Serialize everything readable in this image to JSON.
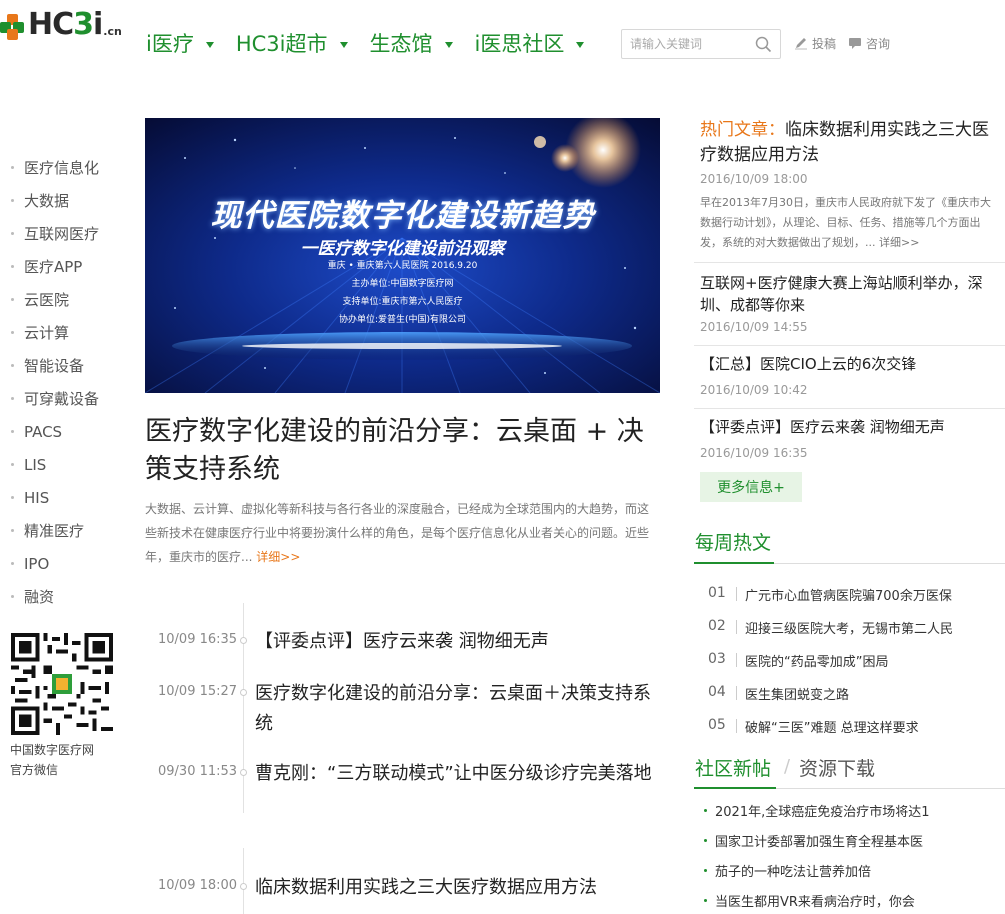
{
  "header": {
    "logo_text": "HC3i",
    "logo_suffix": ".cn",
    "nav": [
      {
        "label": "i医疗"
      },
      {
        "label": "HC3i超市"
      },
      {
        "label": "生态馆"
      },
      {
        "label": "i医思社区"
      }
    ],
    "search_placeholder": "请输入关键词",
    "contribute_label": "投稿",
    "consult_label": "咨询"
  },
  "sidebar": {
    "items": [
      "医疗信息化",
      "大数据",
      "互联网医疗",
      "医疗APP",
      "云医院",
      "云计算",
      "智能设备",
      "可穿戴设备",
      "PACS",
      "LIS",
      "HIS",
      "精准医疗",
      "IPO",
      "融资"
    ],
    "qr_caption_line1": "中国数字医疗网",
    "qr_caption_line2": "官方微信"
  },
  "hero": {
    "title": "现代医院数字化建设新趋势",
    "subtitle": "一医疗数字化建设前沿观察",
    "line1": "重庆 • 重庆第六人民医院  2016.9.20",
    "line2": "主办单位:中国数字医疗网",
    "line3": "支持单位:重庆市第六人民医疗",
    "line4": "协办单位:爱普生(中国)有限公司"
  },
  "lead": {
    "title": "医疗数字化建设的前沿分享：云桌面 + 决策支持系统",
    "summary": "大数据、云计算、虚拟化等新科技与各行各业的深度融合，已经成为全球范围内的大趋势，而这些新技术在健康医疗行业中将要扮演什么样的角色，是每个医疗信息化从业者关心的问题。近些年，重庆市的医疗... ",
    "more": "详细>>"
  },
  "timeline": [
    {
      "time": "10/09 16:35",
      "title": "【评委点评】医疗云来袭 润物细无声"
    },
    {
      "time": "10/09 15:27",
      "title": "医疗数字化建设的前沿分享：云桌面＋决策支持系统"
    },
    {
      "time": "09/30 11:53",
      "title": "曹克刚：“三方联动模式”让中医分级诊疗完美落地"
    },
    {
      "time": "10/09 18:00",
      "title": "临床数据利用实践之三大医疗数据应用方法"
    }
  ],
  "hot": {
    "label": "热门文章：",
    "title": "临床数据利用实践之三大医疗数据应用方法",
    "date": "2016/10/09 18:00",
    "summary": "早在2013年7月30日，重庆市人民政府就下发了《重庆市大数据行动计划》，从理论、目标、任务、措施等几个方面出发，系统的对大数据做出了规划，... ",
    "more": "详细>>"
  },
  "articles": [
    {
      "title": "互联网+医疗健康大赛上海站顺利举办，深圳、成都等你来",
      "date": "2016/10/09 14:55"
    },
    {
      "title": "【汇总】医院CIO上云的6次交锋",
      "date": "2016/10/09 10:42"
    },
    {
      "title": "【评委点评】医疗云来袭 润物细无声",
      "date": "2016/10/09 16:35"
    }
  ],
  "more_info": "更多信息+",
  "weekly": {
    "title": "每周热文",
    "items": [
      {
        "num": "01",
        "title": "广元市心血管病医院骗700余万医保"
      },
      {
        "num": "02",
        "title": "迎接三级医院大考，无锡市第二人民"
      },
      {
        "num": "03",
        "title": "医院的“药品零加成”困局"
      },
      {
        "num": "04",
        "title": "医生集团蜕变之路"
      },
      {
        "num": "05",
        "title": "破解“三医”难题 总理这样要求"
      }
    ]
  },
  "forum": {
    "tab_active": "社区新帖",
    "tab_sep": "/",
    "tab_other": "资源下载",
    "items": [
      "2021年,全球癌症免疫治疗市场将达1",
      "国家卫计委部署加强生育全程基本医",
      "茄子的一种吃法让营养加倍",
      "当医生都用VR来看病治疗时，你会"
    ]
  },
  "colors": {
    "brand_green": "#1f8f2e",
    "accent_orange": "#e8771a"
  }
}
